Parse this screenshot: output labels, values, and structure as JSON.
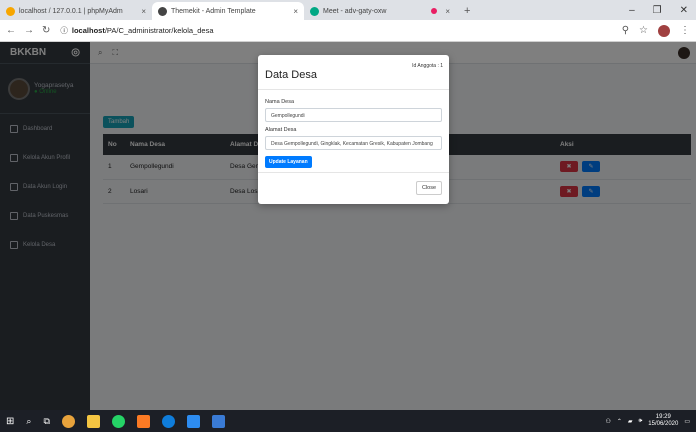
{
  "browser": {
    "tabs": [
      {
        "label": "localhost / 127.0.0.1 | phpMyAdm",
        "close": "×",
        "color": "#f7a600"
      },
      {
        "label": "Themekit - Admin Template",
        "close": "×",
        "color": "#444"
      },
      {
        "label": "Meet - adv-gaty-oxw",
        "close": "",
        "color": "#00a884"
      }
    ],
    "recording_dot_color": "#e91e63",
    "newtab": "+",
    "address": {
      "host": "localhost",
      "path": "/PA/C_administrator/kelola_desa"
    },
    "win_controls": [
      "–",
      "❐",
      "✕"
    ]
  },
  "sidebar": {
    "brand": "BKKBN",
    "brand_toggle": "◎",
    "user_name": "Yogaprasetya",
    "user_status": "● Online",
    "items": [
      {
        "label": "Dashboard"
      },
      {
        "label": "Kelola Akun Profil"
      },
      {
        "label": "Data Akun Login"
      },
      {
        "label": "Data Puskesmas"
      },
      {
        "label": "Kelola Desa"
      }
    ]
  },
  "topnav": {
    "search_icon": "⌕",
    "expand_icon": "⛶"
  },
  "content": {
    "add_button": "Tambah",
    "table": {
      "headers": [
        "No",
        "Nama Desa",
        "Alamat Desa",
        "Aksi"
      ],
      "rows": [
        {
          "no": "1",
          "nama": "Gempollegundi",
          "alamat": "Desa Gempollegundi, Gingklak, Kecamatan Gresik, Kabupaten Jombang"
        },
        {
          "no": "2",
          "nama": "Losari",
          "alamat": "Desa Losari"
        }
      ],
      "delete_icon": "✖",
      "edit_icon": "✎"
    }
  },
  "modal": {
    "title": "Data Desa",
    "id_label": "Id Anggota : 1",
    "fields": [
      {
        "label": "Nama Desa",
        "value": "Gempollegundi"
      },
      {
        "label": "Alamat Desa",
        "value": "Desa Gempollegundi, Gingklak, Kecamatan Gresik, Kabupaten Jombang"
      }
    ],
    "update_button": "Update Layanan",
    "close_button": "Close"
  },
  "taskbar": {
    "time": "19:29",
    "date": "15/06/2020"
  }
}
